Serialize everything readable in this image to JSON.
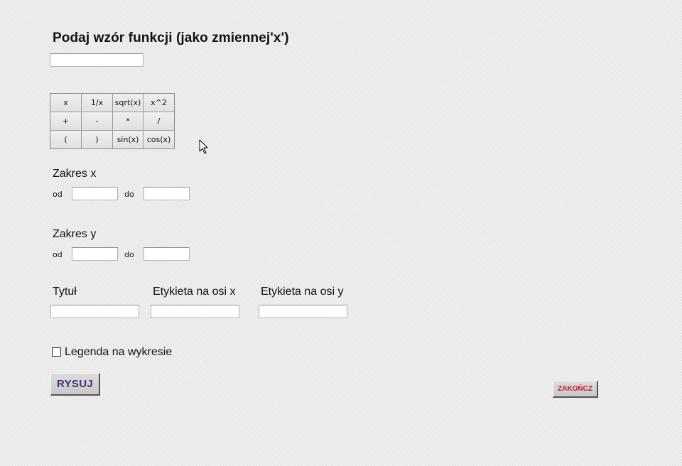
{
  "formula": {
    "title": "Podaj wzór funkcji (jako zmiennej'x')",
    "input_value": ""
  },
  "keypad": {
    "keys": [
      "x",
      "1/x",
      "sqrt(x)",
      "x^2",
      "+",
      "-",
      "*",
      "/",
      "(",
      ")",
      "sin(x)",
      "cos(x)"
    ]
  },
  "range_x": {
    "label": "Zakres x",
    "from_label": "od",
    "to_label": "do",
    "from_value": "",
    "to_value": ""
  },
  "range_y": {
    "label": "Zakres y",
    "from_label": "od",
    "to_label": "do",
    "from_value": "",
    "to_value": ""
  },
  "labels": {
    "title_label": "Tytuł",
    "xaxis_label": "Etykieta na osi x",
    "yaxis_label": "Etykieta na osi y",
    "title_value": "",
    "xaxis_value": "",
    "yaxis_value": ""
  },
  "legend": {
    "label": "Legenda na wykresie",
    "checked": false
  },
  "buttons": {
    "draw": "RYSUJ",
    "exit": "ZAKOŃCZ"
  },
  "colors": {
    "draw_text": "#4a2e7c",
    "exit_text": "#c8182a"
  },
  "icons": {
    "pointer": "mouse-pointer-icon"
  }
}
